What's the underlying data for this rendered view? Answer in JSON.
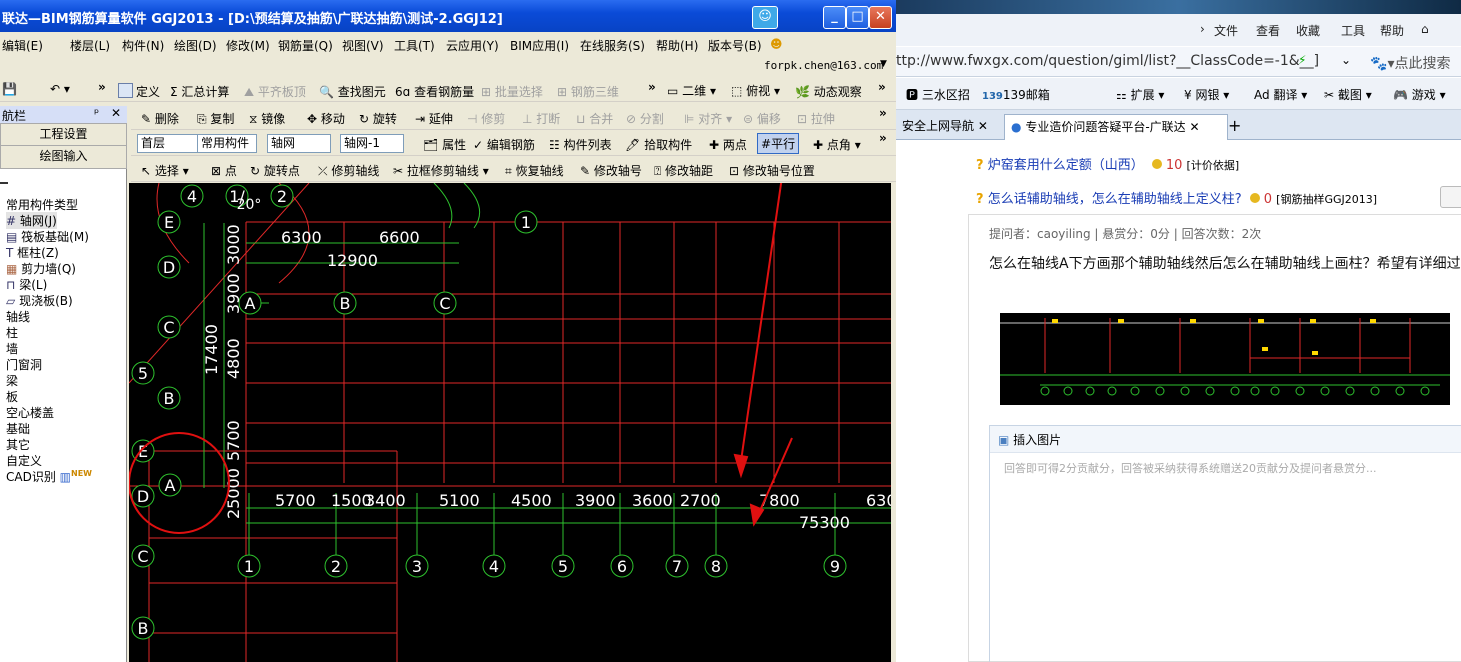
{
  "app": {
    "title": "联达—BIM钢筋算量软件 GGJ2013 - [D:\\预结算及抽筋\\广联达抽筋\\测试-2.GGJ12]",
    "menu": [
      "编辑(E)",
      "楼层(L)",
      "构件(N)",
      "绘图(D)",
      "修改(M)",
      "钢筋量(Q)",
      "视图(V)",
      "工具(T)",
      "云应用(Y)",
      "BIM应用(I)",
      "在线服务(S)",
      "帮助(H)",
      "版本号(B)"
    ],
    "email": "forpk.chen@163.com",
    "toolbar1": {
      "define": "定义",
      "sum": "汇总计算",
      "flat": "平齐板顶",
      "find": "查找图元",
      "view_rebar": "查看钢筋量",
      "batch": "批量选择",
      "rebar3d": "钢筋三维",
      "view2d": "二维",
      "view_mode": "俯视",
      "dynamic": "动态观察"
    },
    "panel_title": "航栏",
    "panel_buttons": [
      "工程设置",
      "绘图输入"
    ],
    "tree": [
      "常用构件类型",
      "轴网(J)",
      "筏板基础(M)",
      "框柱(Z)",
      "剪力墙(Q)",
      "梁(L)",
      "现浇板(B)",
      "轴线",
      "柱",
      "墙",
      "门窗洞",
      "梁",
      "板",
      "空心楼盖",
      "基础",
      "其它",
      "自定义",
      "CAD识别"
    ],
    "new_badge": "NEW",
    "toolbar2": {
      "delete": "删除",
      "copy": "复制",
      "mirror": "镜像",
      "move": "移动",
      "rotate": "旋转",
      "extend": "延伸",
      "trim": "修剪",
      "break": "打断",
      "merge": "合并",
      "split": "分割",
      "align": "对齐",
      "offset": "偏移",
      "stretch": "拉伸"
    },
    "toolbar3": {
      "floor": "首层",
      "type": "常用构件",
      "cat": "轴网",
      "axis": "轴网-1",
      "prop": "属性",
      "edit_rebar": "编辑钢筋",
      "list": "构件列表",
      "pick": "拾取构件",
      "two_pt": "两点",
      "parallel": "平行",
      "angle": "点角"
    },
    "toolbar4": {
      "select": "选择",
      "point": "点",
      "rot_point": "旋转点",
      "trim_axis": "修剪轴线",
      "stretch_trim": "拉框修剪轴线",
      "restore": "恢复轴线",
      "edit_no": "修改轴号",
      "edit_dist": "修改轴距",
      "edit_pos": "修改轴号位置"
    },
    "cad": {
      "top_dims": [
        "6300",
        "6600",
        "12900"
      ],
      "bottom_dims": [
        "5700",
        "1500",
        "3400",
        "5100",
        "4500",
        "3900",
        "3600",
        "2700",
        "7800",
        "630",
        "75300"
      ],
      "side_dims": [
        "3000",
        "3900",
        "4800",
        "17400",
        "5700",
        "25000"
      ],
      "axis_bubbles_top": [
        "4",
        "1/",
        "2",
        "1"
      ],
      "axis_bubbles_mid": [
        "A",
        "B",
        "C"
      ],
      "axis_bubbles_bottom": [
        "1",
        "2",
        "3",
        "4",
        "5",
        "6",
        "7",
        "8",
        "9"
      ],
      "axis_bubbles_left": [
        "E",
        "D",
        "C",
        "5",
        "B",
        "E",
        "A",
        "D",
        "C",
        "B"
      ],
      "angle": "20°"
    }
  },
  "browser": {
    "menu": [
      "文件",
      "查看",
      "收藏",
      "工具",
      "帮助"
    ],
    "url": "ttp://www.fwxgx.com/question/giml/list?__ClassCode=-1&__]",
    "search_placeholder": "点此搜索",
    "bar2": [
      "三水区招",
      "139邮箱",
      "扩展",
      "网银",
      "翻译",
      "截图",
      "游戏"
    ],
    "tabs": [
      "安全上网导航",
      "专业造价问题答疑平台-广联达"
    ],
    "q1": {
      "title": "炉窑套用什么定额（山西）",
      "reward": "10",
      "tag": "[计价依据]"
    },
    "q2": {
      "title": "怎么话辅助轴线，怎么在辅助轴线上定义柱?",
      "reward": "0",
      "tag": "[钢筋抽样GGJ2013]"
    },
    "meta": "提问者：caoyiling  |  悬赏分：0分  |  回答次数：2次",
    "question": "怎么在轴线A下方画那个辅助轴线然后怎么在辅助轴线上画柱？希望有详细过",
    "insert_image": "插入图片",
    "answer_placeholder": "回答即可得2分贡献分，回答被采纳获得系统赠送20贡献分及提问者悬赏分..."
  }
}
